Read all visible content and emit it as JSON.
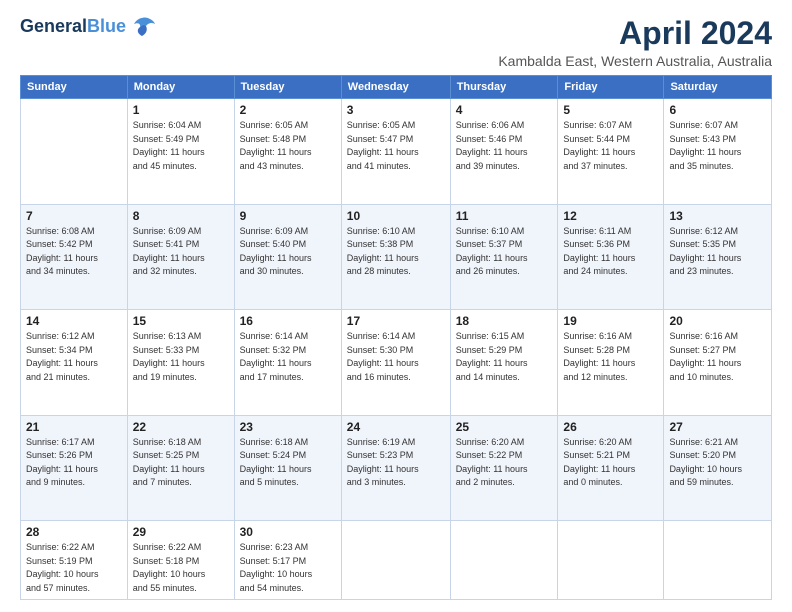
{
  "header": {
    "logo_line1": "General",
    "logo_line2": "Blue",
    "month": "April 2024",
    "location": "Kambalda East, Western Australia, Australia"
  },
  "weekdays": [
    "Sunday",
    "Monday",
    "Tuesday",
    "Wednesday",
    "Thursday",
    "Friday",
    "Saturday"
  ],
  "weeks": [
    [
      {
        "day": "",
        "info": ""
      },
      {
        "day": "1",
        "info": "Sunrise: 6:04 AM\nSunset: 5:49 PM\nDaylight: 11 hours\nand 45 minutes."
      },
      {
        "day": "2",
        "info": "Sunrise: 6:05 AM\nSunset: 5:48 PM\nDaylight: 11 hours\nand 43 minutes."
      },
      {
        "day": "3",
        "info": "Sunrise: 6:05 AM\nSunset: 5:47 PM\nDaylight: 11 hours\nand 41 minutes."
      },
      {
        "day": "4",
        "info": "Sunrise: 6:06 AM\nSunset: 5:46 PM\nDaylight: 11 hours\nand 39 minutes."
      },
      {
        "day": "5",
        "info": "Sunrise: 6:07 AM\nSunset: 5:44 PM\nDaylight: 11 hours\nand 37 minutes."
      },
      {
        "day": "6",
        "info": "Sunrise: 6:07 AM\nSunset: 5:43 PM\nDaylight: 11 hours\nand 35 minutes."
      }
    ],
    [
      {
        "day": "7",
        "info": "Sunrise: 6:08 AM\nSunset: 5:42 PM\nDaylight: 11 hours\nand 34 minutes."
      },
      {
        "day": "8",
        "info": "Sunrise: 6:09 AM\nSunset: 5:41 PM\nDaylight: 11 hours\nand 32 minutes."
      },
      {
        "day": "9",
        "info": "Sunrise: 6:09 AM\nSunset: 5:40 PM\nDaylight: 11 hours\nand 30 minutes."
      },
      {
        "day": "10",
        "info": "Sunrise: 6:10 AM\nSunset: 5:38 PM\nDaylight: 11 hours\nand 28 minutes."
      },
      {
        "day": "11",
        "info": "Sunrise: 6:10 AM\nSunset: 5:37 PM\nDaylight: 11 hours\nand 26 minutes."
      },
      {
        "day": "12",
        "info": "Sunrise: 6:11 AM\nSunset: 5:36 PM\nDaylight: 11 hours\nand 24 minutes."
      },
      {
        "day": "13",
        "info": "Sunrise: 6:12 AM\nSunset: 5:35 PM\nDaylight: 11 hours\nand 23 minutes."
      }
    ],
    [
      {
        "day": "14",
        "info": "Sunrise: 6:12 AM\nSunset: 5:34 PM\nDaylight: 11 hours\nand 21 minutes."
      },
      {
        "day": "15",
        "info": "Sunrise: 6:13 AM\nSunset: 5:33 PM\nDaylight: 11 hours\nand 19 minutes."
      },
      {
        "day": "16",
        "info": "Sunrise: 6:14 AM\nSunset: 5:32 PM\nDaylight: 11 hours\nand 17 minutes."
      },
      {
        "day": "17",
        "info": "Sunrise: 6:14 AM\nSunset: 5:30 PM\nDaylight: 11 hours\nand 16 minutes."
      },
      {
        "day": "18",
        "info": "Sunrise: 6:15 AM\nSunset: 5:29 PM\nDaylight: 11 hours\nand 14 minutes."
      },
      {
        "day": "19",
        "info": "Sunrise: 6:16 AM\nSunset: 5:28 PM\nDaylight: 11 hours\nand 12 minutes."
      },
      {
        "day": "20",
        "info": "Sunrise: 6:16 AM\nSunset: 5:27 PM\nDaylight: 11 hours\nand 10 minutes."
      }
    ],
    [
      {
        "day": "21",
        "info": "Sunrise: 6:17 AM\nSunset: 5:26 PM\nDaylight: 11 hours\nand 9 minutes."
      },
      {
        "day": "22",
        "info": "Sunrise: 6:18 AM\nSunset: 5:25 PM\nDaylight: 11 hours\nand 7 minutes."
      },
      {
        "day": "23",
        "info": "Sunrise: 6:18 AM\nSunset: 5:24 PM\nDaylight: 11 hours\nand 5 minutes."
      },
      {
        "day": "24",
        "info": "Sunrise: 6:19 AM\nSunset: 5:23 PM\nDaylight: 11 hours\nand 3 minutes."
      },
      {
        "day": "25",
        "info": "Sunrise: 6:20 AM\nSunset: 5:22 PM\nDaylight: 11 hours\nand 2 minutes."
      },
      {
        "day": "26",
        "info": "Sunrise: 6:20 AM\nSunset: 5:21 PM\nDaylight: 11 hours\nand 0 minutes."
      },
      {
        "day": "27",
        "info": "Sunrise: 6:21 AM\nSunset: 5:20 PM\nDaylight: 10 hours\nand 59 minutes."
      }
    ],
    [
      {
        "day": "28",
        "info": "Sunrise: 6:22 AM\nSunset: 5:19 PM\nDaylight: 10 hours\nand 57 minutes."
      },
      {
        "day": "29",
        "info": "Sunrise: 6:22 AM\nSunset: 5:18 PM\nDaylight: 10 hours\nand 55 minutes."
      },
      {
        "day": "30",
        "info": "Sunrise: 6:23 AM\nSunset: 5:17 PM\nDaylight: 10 hours\nand 54 minutes."
      },
      {
        "day": "",
        "info": ""
      },
      {
        "day": "",
        "info": ""
      },
      {
        "day": "",
        "info": ""
      },
      {
        "day": "",
        "info": ""
      }
    ]
  ]
}
